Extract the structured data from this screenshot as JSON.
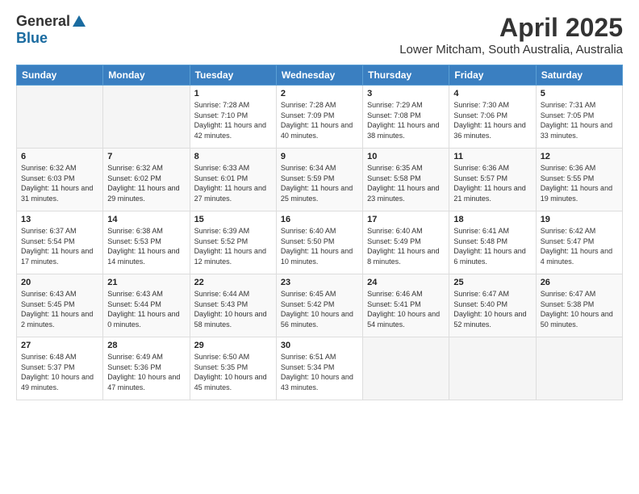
{
  "logo": {
    "general": "General",
    "blue": "Blue"
  },
  "header": {
    "title": "April 2025",
    "location": "Lower Mitcham, South Australia, Australia"
  },
  "weekdays": [
    "Sunday",
    "Monday",
    "Tuesday",
    "Wednesday",
    "Thursday",
    "Friday",
    "Saturday"
  ],
  "weeks": [
    [
      {
        "day": "",
        "info": ""
      },
      {
        "day": "",
        "info": ""
      },
      {
        "day": "1",
        "info": "Sunrise: 7:28 AM\nSunset: 7:10 PM\nDaylight: 11 hours and 42 minutes."
      },
      {
        "day": "2",
        "info": "Sunrise: 7:28 AM\nSunset: 7:09 PM\nDaylight: 11 hours and 40 minutes."
      },
      {
        "day": "3",
        "info": "Sunrise: 7:29 AM\nSunset: 7:08 PM\nDaylight: 11 hours and 38 minutes."
      },
      {
        "day": "4",
        "info": "Sunrise: 7:30 AM\nSunset: 7:06 PM\nDaylight: 11 hours and 36 minutes."
      },
      {
        "day": "5",
        "info": "Sunrise: 7:31 AM\nSunset: 7:05 PM\nDaylight: 11 hours and 33 minutes."
      }
    ],
    [
      {
        "day": "6",
        "info": "Sunrise: 6:32 AM\nSunset: 6:03 PM\nDaylight: 11 hours and 31 minutes."
      },
      {
        "day": "7",
        "info": "Sunrise: 6:32 AM\nSunset: 6:02 PM\nDaylight: 11 hours and 29 minutes."
      },
      {
        "day": "8",
        "info": "Sunrise: 6:33 AM\nSunset: 6:01 PM\nDaylight: 11 hours and 27 minutes."
      },
      {
        "day": "9",
        "info": "Sunrise: 6:34 AM\nSunset: 5:59 PM\nDaylight: 11 hours and 25 minutes."
      },
      {
        "day": "10",
        "info": "Sunrise: 6:35 AM\nSunset: 5:58 PM\nDaylight: 11 hours and 23 minutes."
      },
      {
        "day": "11",
        "info": "Sunrise: 6:36 AM\nSunset: 5:57 PM\nDaylight: 11 hours and 21 minutes."
      },
      {
        "day": "12",
        "info": "Sunrise: 6:36 AM\nSunset: 5:55 PM\nDaylight: 11 hours and 19 minutes."
      }
    ],
    [
      {
        "day": "13",
        "info": "Sunrise: 6:37 AM\nSunset: 5:54 PM\nDaylight: 11 hours and 17 minutes."
      },
      {
        "day": "14",
        "info": "Sunrise: 6:38 AM\nSunset: 5:53 PM\nDaylight: 11 hours and 14 minutes."
      },
      {
        "day": "15",
        "info": "Sunrise: 6:39 AM\nSunset: 5:52 PM\nDaylight: 11 hours and 12 minutes."
      },
      {
        "day": "16",
        "info": "Sunrise: 6:40 AM\nSunset: 5:50 PM\nDaylight: 11 hours and 10 minutes."
      },
      {
        "day": "17",
        "info": "Sunrise: 6:40 AM\nSunset: 5:49 PM\nDaylight: 11 hours and 8 minutes."
      },
      {
        "day": "18",
        "info": "Sunrise: 6:41 AM\nSunset: 5:48 PM\nDaylight: 11 hours and 6 minutes."
      },
      {
        "day": "19",
        "info": "Sunrise: 6:42 AM\nSunset: 5:47 PM\nDaylight: 11 hours and 4 minutes."
      }
    ],
    [
      {
        "day": "20",
        "info": "Sunrise: 6:43 AM\nSunset: 5:45 PM\nDaylight: 11 hours and 2 minutes."
      },
      {
        "day": "21",
        "info": "Sunrise: 6:43 AM\nSunset: 5:44 PM\nDaylight: 11 hours and 0 minutes."
      },
      {
        "day": "22",
        "info": "Sunrise: 6:44 AM\nSunset: 5:43 PM\nDaylight: 10 hours and 58 minutes."
      },
      {
        "day": "23",
        "info": "Sunrise: 6:45 AM\nSunset: 5:42 PM\nDaylight: 10 hours and 56 minutes."
      },
      {
        "day": "24",
        "info": "Sunrise: 6:46 AM\nSunset: 5:41 PM\nDaylight: 10 hours and 54 minutes."
      },
      {
        "day": "25",
        "info": "Sunrise: 6:47 AM\nSunset: 5:40 PM\nDaylight: 10 hours and 52 minutes."
      },
      {
        "day": "26",
        "info": "Sunrise: 6:47 AM\nSunset: 5:38 PM\nDaylight: 10 hours and 50 minutes."
      }
    ],
    [
      {
        "day": "27",
        "info": "Sunrise: 6:48 AM\nSunset: 5:37 PM\nDaylight: 10 hours and 49 minutes."
      },
      {
        "day": "28",
        "info": "Sunrise: 6:49 AM\nSunset: 5:36 PM\nDaylight: 10 hours and 47 minutes."
      },
      {
        "day": "29",
        "info": "Sunrise: 6:50 AM\nSunset: 5:35 PM\nDaylight: 10 hours and 45 minutes."
      },
      {
        "day": "30",
        "info": "Sunrise: 6:51 AM\nSunset: 5:34 PM\nDaylight: 10 hours and 43 minutes."
      },
      {
        "day": "",
        "info": ""
      },
      {
        "day": "",
        "info": ""
      },
      {
        "day": "",
        "info": ""
      }
    ]
  ]
}
